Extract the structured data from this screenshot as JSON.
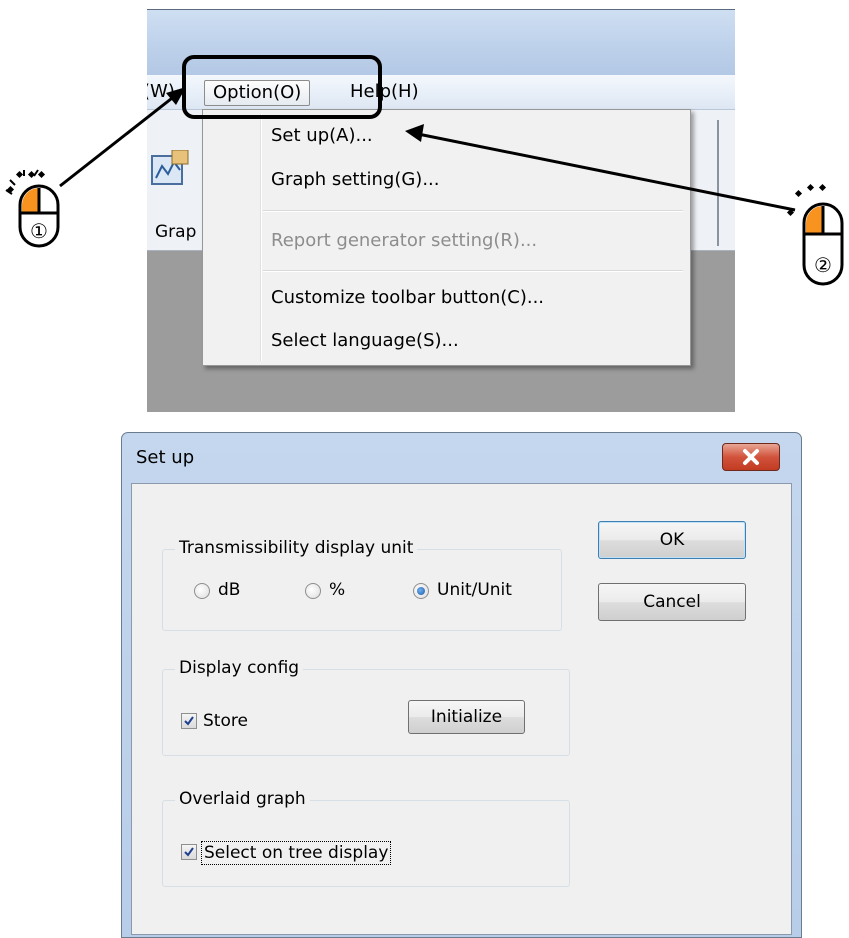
{
  "menubar": {
    "partial_item": "(W)",
    "option_label": "Option(O)",
    "help_label": "Help(H)"
  },
  "toolbar": {
    "graph_label_partial": "Grap"
  },
  "option_menu": {
    "items": [
      {
        "label": "Set up(A)...",
        "enabled": true
      },
      {
        "label": "Graph setting(G)...",
        "enabled": true
      },
      {
        "label": "Report generator setting(R)...",
        "enabled": false
      },
      {
        "label": "Customize toolbar button(C)...",
        "enabled": true
      },
      {
        "label": "Select language(S)...",
        "enabled": true
      }
    ]
  },
  "dialog": {
    "title": "Set up",
    "close_icon": "close-x-icon",
    "ok_label": "OK",
    "cancel_label": "Cancel",
    "transmissibility": {
      "title": "Transmissibility display unit",
      "options": [
        "dB",
        "%",
        "Unit/Unit"
      ],
      "selected": "Unit/Unit"
    },
    "display_config": {
      "title": "Display config",
      "store_label": "Store",
      "store_checked": true,
      "initialize_label": "Initialize"
    },
    "overlaid_graph": {
      "title": "Overlaid graph",
      "select_label": "Select on tree display",
      "select_checked": true
    }
  },
  "annotations": {
    "step1": "①",
    "step2": "②",
    "mouse_icon": "mouse-left-click-icon",
    "accent_color": "#f7931e"
  }
}
